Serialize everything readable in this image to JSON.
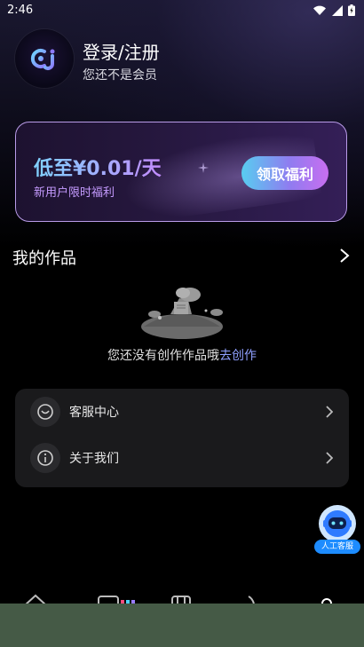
{
  "status_bar": {
    "time": "2:46"
  },
  "profile": {
    "title": "登录/注册",
    "subtitle": "您还不是会员"
  },
  "promo": {
    "price": "低至¥0.01/天",
    "subtitle": "新用户限时福利",
    "button": "领取福利"
  },
  "works": {
    "title": "我的作品",
    "empty_text": "您还没有创作作品哦",
    "empty_link": "去创作"
  },
  "menu": {
    "items": [
      {
        "label": "客服中心",
        "icon": "headset-icon"
      },
      {
        "label": "关于我们",
        "icon": "info-icon"
      }
    ]
  },
  "support": {
    "label": "人工客服"
  },
  "colors": {
    "accent_gradient_start": "#58cdf0",
    "accent_gradient_end": "#c86ef0",
    "link": "#8fa0ff",
    "card_border": "#b99be8"
  }
}
